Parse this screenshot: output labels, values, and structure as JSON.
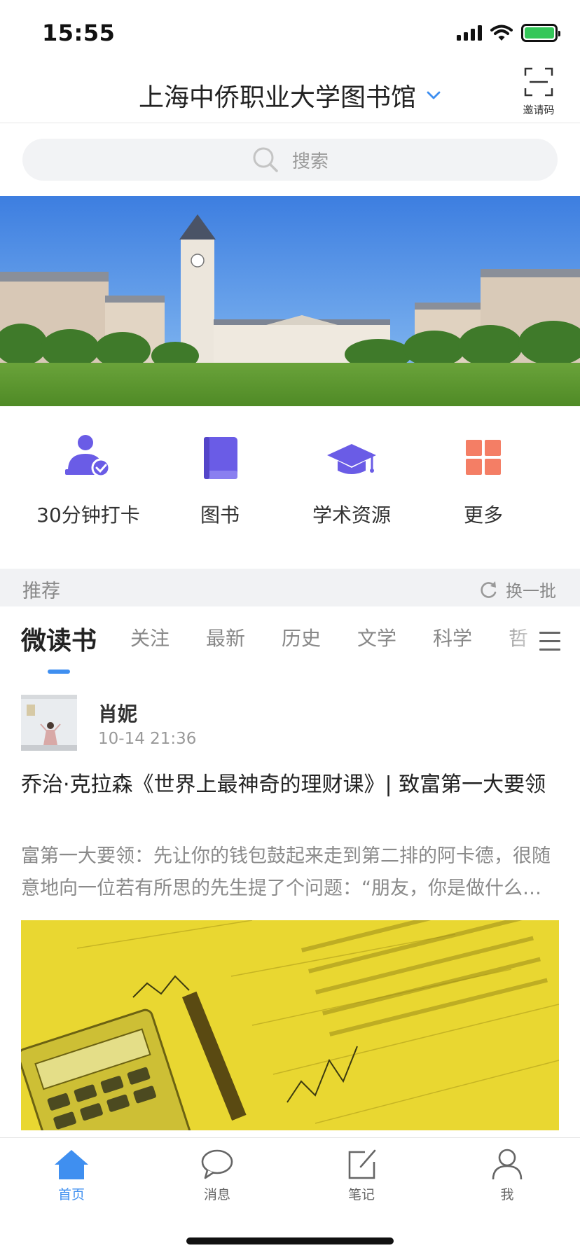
{
  "status_bar": {
    "time": "15:55"
  },
  "header": {
    "title": "上海中侨职业大学图书馆",
    "invite_label": "邀请码"
  },
  "search": {
    "placeholder": "搜索"
  },
  "actions": [
    {
      "label": "30分钟打卡",
      "icon": "user-check-icon"
    },
    {
      "label": "图书",
      "icon": "book-icon"
    },
    {
      "label": "学术资源",
      "icon": "graduation-cap-icon"
    },
    {
      "label": "更多",
      "icon": "grid-icon"
    }
  ],
  "recommend": {
    "title": "推荐",
    "refresh_label": "换一批"
  },
  "tabs": [
    "微读书",
    "关注",
    "最新",
    "历史",
    "文学",
    "科学",
    "哲"
  ],
  "article": {
    "author": "肖妮",
    "time": "10-14 21:36",
    "title": "乔治·克拉森《世界上最神奇的理财课》| 致富第一大要领",
    "excerpt": "富第一大要领：先让你的钱包鼓起来走到第二排的阿卡德，很随意地向一位若有所思的先生提了个问题：“朋友，你是做什么工作的？”"
  },
  "bottom_nav": [
    {
      "label": "首页",
      "icon": "home-icon",
      "active": true
    },
    {
      "label": "消息",
      "icon": "message-icon",
      "active": false
    },
    {
      "label": "笔记",
      "icon": "note-icon",
      "active": false
    },
    {
      "label": "我",
      "icon": "user-icon",
      "active": false
    }
  ],
  "colors": {
    "accent": "#3f8ff0",
    "icon_purple": "#6a5ce6",
    "icon_orange": "#f47e65",
    "battery_green": "#34c759"
  }
}
